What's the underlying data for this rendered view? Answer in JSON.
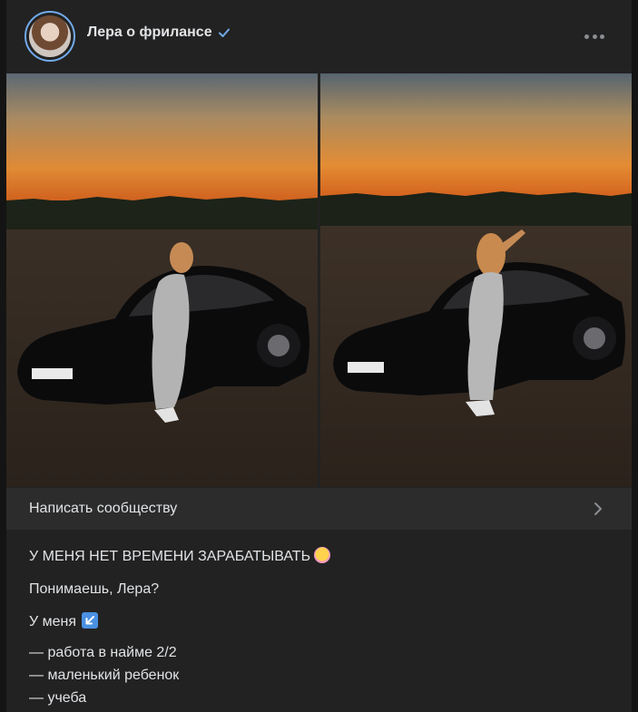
{
  "header": {
    "community_name": "Лера о фрилансе",
    "avatar_icon": "avatar-photo",
    "verified_icon": "checkmark-icon",
    "more_icon": "more-dots-icon"
  },
  "photos": [
    {
      "name": "photo-1",
      "description_icon": "photo"
    },
    {
      "name": "photo-2",
      "description_icon": "photo"
    }
  ],
  "write_bar": {
    "label": "Написать сообществу"
  },
  "post": {
    "line1": "У МЕНЯ НЕТ ВРЕМЕНИ ЗАРАБАТЫВАТЬ",
    "line2": "Понимаешь, Лера?",
    "line3": "У меня",
    "list": [
      "— работа в найме 2/2",
      "— маленький ребенок",
      "— учеба"
    ]
  },
  "colors": {
    "background": "#141414",
    "card": "#222222",
    "bar": "#2c2c2c",
    "accent": "#71aaeb",
    "text": "#e1e3e6"
  }
}
